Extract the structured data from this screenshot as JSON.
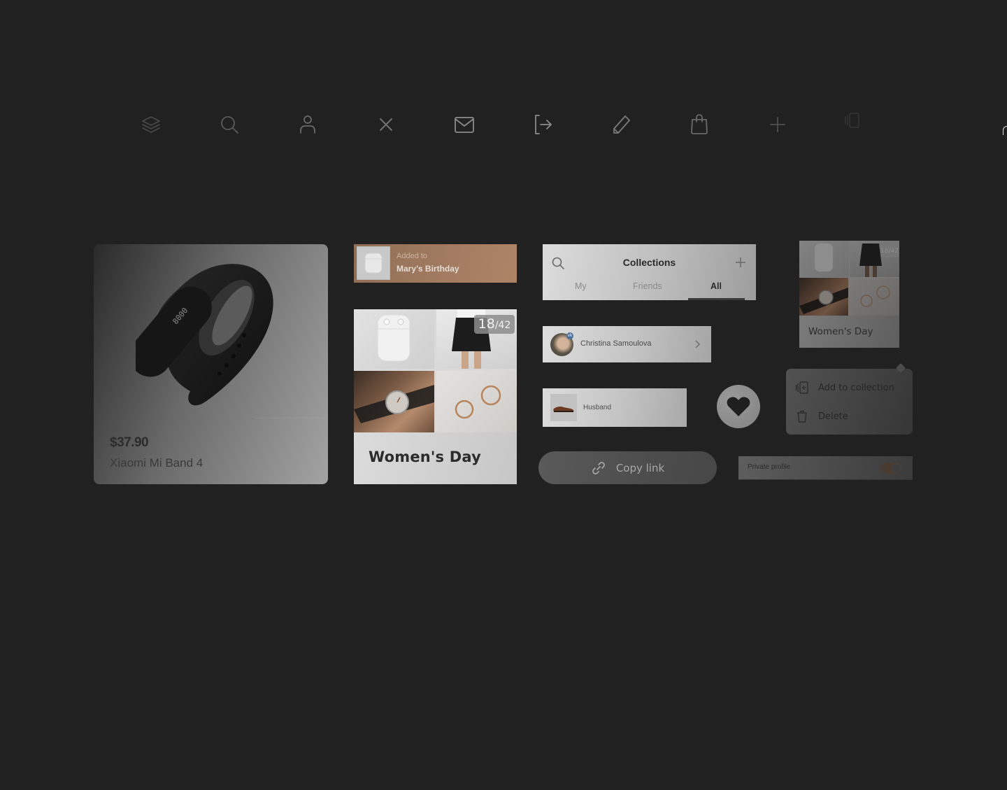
{
  "icon_row": [
    {
      "name": "layers-icon",
      "color": "#4a4a4a"
    },
    {
      "name": "search-icon",
      "color": "#5a5a5a"
    },
    {
      "name": "user-icon",
      "color": "#6a6a6a"
    },
    {
      "name": "close-icon",
      "color": "#7a7a7a"
    },
    {
      "name": "mail-icon",
      "color": "#8a8a8a"
    },
    {
      "name": "logout-icon",
      "color": "#8a8a8a"
    },
    {
      "name": "pencil-icon",
      "color": "#7a7a7a"
    },
    {
      "name": "shopping-bag-icon",
      "color": "#6a6a6a"
    },
    {
      "name": "plus-icon",
      "color": "#4f4f4f"
    },
    {
      "name": "add-to-collection-icon",
      "color": "#333333"
    }
  ],
  "product_card": {
    "price": "$37.90",
    "name": "Xiaomi Mi Band 4",
    "screen_reading": "8000"
  },
  "added_toast": {
    "label": "Added to",
    "target": "Mary’s Birthday",
    "accent": "#a37c61"
  },
  "collection_card": {
    "title": "Women's Day",
    "count_current": "18",
    "count_separator": "/",
    "count_total": "42"
  },
  "collections_header": {
    "title": "Collections",
    "tabs": [
      {
        "label": "My",
        "active": false
      },
      {
        "label": "Friends",
        "active": false
      },
      {
        "label": "All",
        "active": true
      }
    ]
  },
  "person_row": {
    "name": "Christina Samoulova",
    "badge": "vk",
    "badge_color": "#4a6f9a"
  },
  "husband_row": {
    "label": "Husband"
  },
  "copy_link": {
    "label": "Copy link"
  },
  "mini_collection": {
    "title": "Women's Day",
    "count": "18/42"
  },
  "context_menu": {
    "items": [
      {
        "label": "Add to collection",
        "icon": "add-to-collection-icon"
      },
      {
        "label": "Delete",
        "icon": "trash-icon"
      }
    ]
  },
  "private_profile": {
    "label": "Private profile",
    "enabled": true
  }
}
